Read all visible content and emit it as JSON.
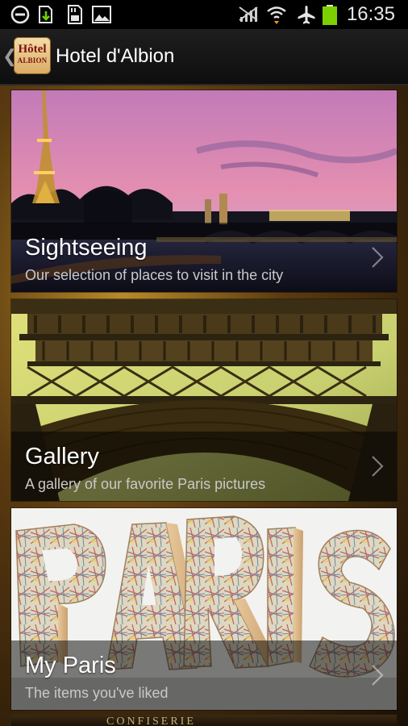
{
  "status_bar": {
    "time": "16:35",
    "icons": [
      "block-icon",
      "download-icon",
      "sd-card-icon",
      "image-icon",
      "signal-off-icon",
      "wifi-icon",
      "airplane-icon",
      "battery-icon"
    ]
  },
  "action_bar": {
    "title": "Hotel d'Albion",
    "logo_line1": "Hôtel",
    "logo_line2": "ALBION"
  },
  "cards": [
    {
      "title": "Sightseeing",
      "subtitle": "Our selection of places to visit in the city"
    },
    {
      "title": "Gallery",
      "subtitle": "A gallery of our favorite Paris pictures"
    },
    {
      "title": "My Paris",
      "subtitle": "The items you've liked"
    }
  ],
  "next_card_peek_text": "CONFISERIE",
  "colors": {
    "status_bar_bg": "#000000",
    "action_bar_bg": "#141414",
    "battery": "#7cd000",
    "title_text": "#ffffff",
    "subtitle_text": "#c9c9c9"
  }
}
